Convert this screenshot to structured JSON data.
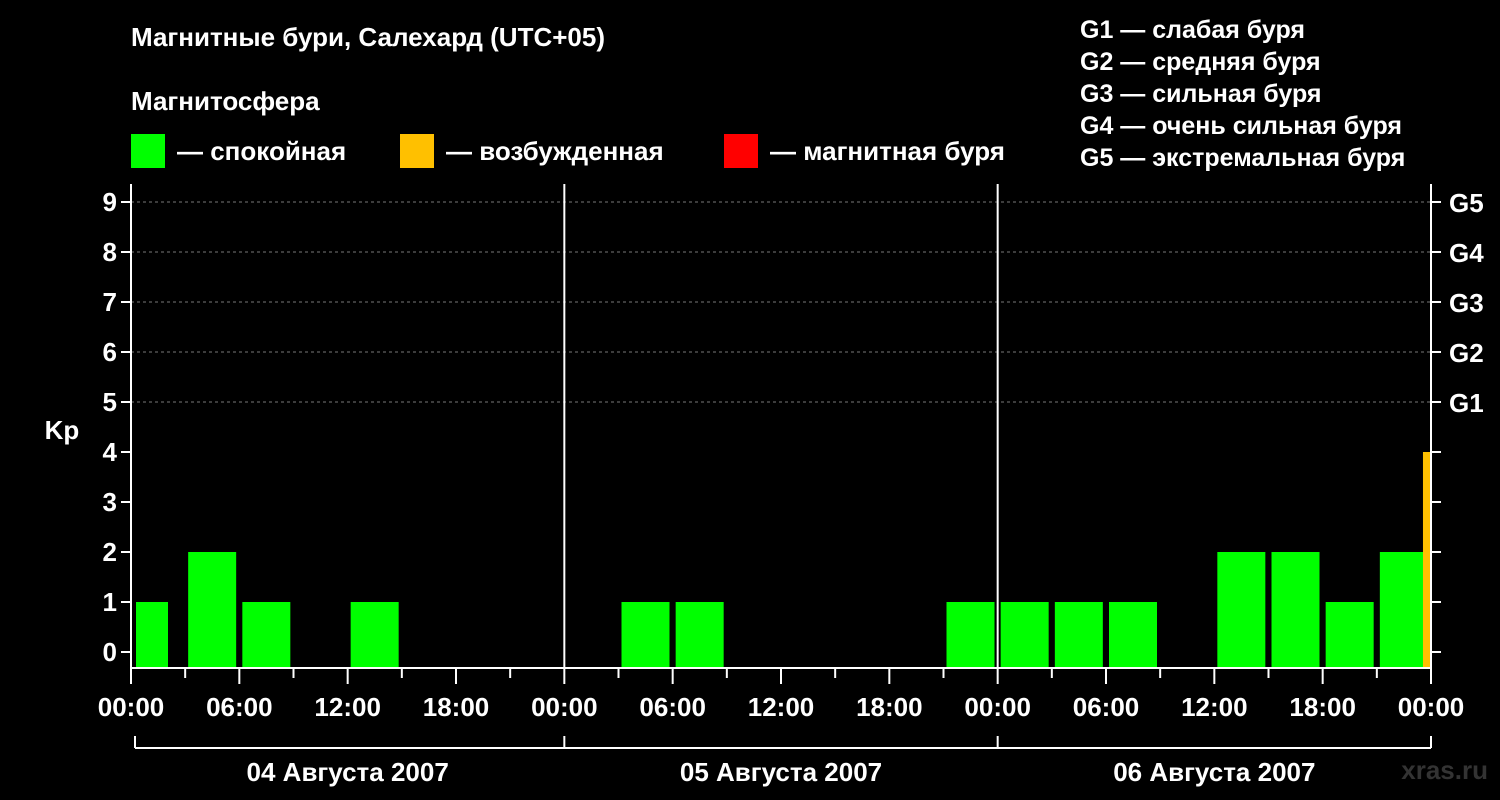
{
  "title": "Магнитные бури, Салехард (UTC+05)",
  "subtitle": "Магнитосфера",
  "legend": [
    {
      "label": "— спокойная",
      "color": "#00ff00"
    },
    {
      "label": "— возбужденная",
      "color": "#ffc000"
    },
    {
      "label": "— магнитная буря",
      "color": "#ff0000"
    }
  ],
  "g_scale": [
    "G1 — слабая буря",
    "G2 — средняя буря",
    "G3 — сильная буря",
    "G4 — очень сильная буря",
    "G5 — экстремальная буря"
  ],
  "watermark": "xras.ru",
  "chart_data": {
    "type": "bar",
    "ylabel": "Kp",
    "ylim": [
      0,
      9
    ],
    "yticks": [
      "0",
      "1",
      "2",
      "3",
      "4",
      "5",
      "6",
      "7",
      "8",
      "9"
    ],
    "right_ticks": [
      {
        "kp": 5,
        "label": "G1"
      },
      {
        "kp": 6,
        "label": "G2"
      },
      {
        "kp": 7,
        "label": "G3"
      },
      {
        "kp": 8,
        "label": "G4"
      },
      {
        "kp": 9,
        "label": "G5"
      }
    ],
    "xticks": [
      "00:00",
      "06:00",
      "12:00",
      "18:00",
      "00:00",
      "06:00",
      "12:00",
      "18:00",
      "00:00",
      "06:00",
      "12:00",
      "18:00",
      "00:00"
    ],
    "days": [
      "04 Августа 2007",
      "05 Августа 2007",
      "06 Августа 2007"
    ],
    "grid": "horizontal dashed",
    "series": [
      {
        "values": [
          {
            "start": "04 Августа 2007 00:00",
            "kp": 1,
            "status": "спокойная"
          },
          {
            "start": "04 Августа 2007 03:00",
            "kp": 2,
            "status": "спокойная"
          },
          {
            "start": "04 Августа 2007 06:00",
            "kp": 1,
            "status": "спокойная"
          },
          {
            "start": "04 Августа 2007 09:00",
            "kp": 0,
            "status": "спокойная"
          },
          {
            "start": "04 Августа 2007 12:00",
            "kp": 1,
            "status": "спокойная"
          },
          {
            "start": "04 Августа 2007 15:00",
            "kp": 0,
            "status": "спокойная"
          },
          {
            "start": "04 Августа 2007 18:00",
            "kp": 0,
            "status": "спокойная"
          },
          {
            "start": "04 Августа 2007 21:00",
            "kp": 0,
            "status": "спокойная"
          },
          {
            "start": "05 Августа 2007 00:00",
            "kp": 0,
            "status": "спокойная"
          },
          {
            "start": "05 Августа 2007 03:00",
            "kp": 1,
            "status": "спокойная"
          },
          {
            "start": "05 Августа 2007 06:00",
            "kp": 1,
            "status": "спокойная"
          },
          {
            "start": "05 Августа 2007 09:00",
            "kp": 0,
            "status": "спокойная"
          },
          {
            "start": "05 Августа 2007 12:00",
            "kp": 0,
            "status": "спокойная"
          },
          {
            "start": "05 Августа 2007 15:00",
            "kp": 0,
            "status": "спокойная"
          },
          {
            "start": "05 Августа 2007 18:00",
            "kp": 0,
            "status": "спокойная"
          },
          {
            "start": "05 Августа 2007 21:00",
            "kp": 1,
            "status": "спокойная"
          },
          {
            "start": "06 Августа 2007 00:00",
            "kp": 1,
            "status": "спокойная"
          },
          {
            "start": "06 Августа 2007 03:00",
            "kp": 1,
            "status": "спокойная"
          },
          {
            "start": "06 Августа 2007 06:00",
            "kp": 1,
            "status": "спокойная"
          },
          {
            "start": "06 Августа 2007 09:00",
            "kp": 0,
            "status": "спокойная"
          },
          {
            "start": "06 Августа 2007 12:00",
            "kp": 2,
            "status": "спокойная"
          },
          {
            "start": "06 Августа 2007 15:00",
            "kp": 2,
            "status": "спокойная"
          },
          {
            "start": "06 Августа 2007 18:00",
            "kp": 1,
            "status": "спокойная"
          },
          {
            "start": "06 Августа 2007 21:00",
            "kp": 2,
            "status": "спокойная"
          },
          {
            "start": "06 Августа 2007 23:30",
            "kp": 4,
            "status": "возбужденная"
          }
        ]
      }
    ]
  }
}
